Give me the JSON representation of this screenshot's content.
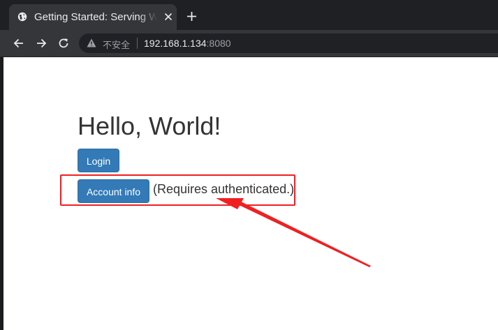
{
  "browser": {
    "tab": {
      "title": "Getting Started: Serving Web Content",
      "icons": [
        "globe-icon",
        "close-icon"
      ]
    },
    "new_tab_icon": "plus-icon",
    "nav_icons": [
      "back-arrow-icon",
      "forward-arrow-icon",
      "reload-icon"
    ],
    "address_bar": {
      "security_icon": "warning-triangle-icon",
      "security_label": "不安全",
      "host": "192.168.1.134",
      "port": ":8080"
    }
  },
  "page": {
    "heading": "Hello, World!",
    "login_button": "Login",
    "account_button": "Account info",
    "account_note": "(Requires authenticated.)"
  },
  "annotation": {
    "color": "#f02020"
  }
}
